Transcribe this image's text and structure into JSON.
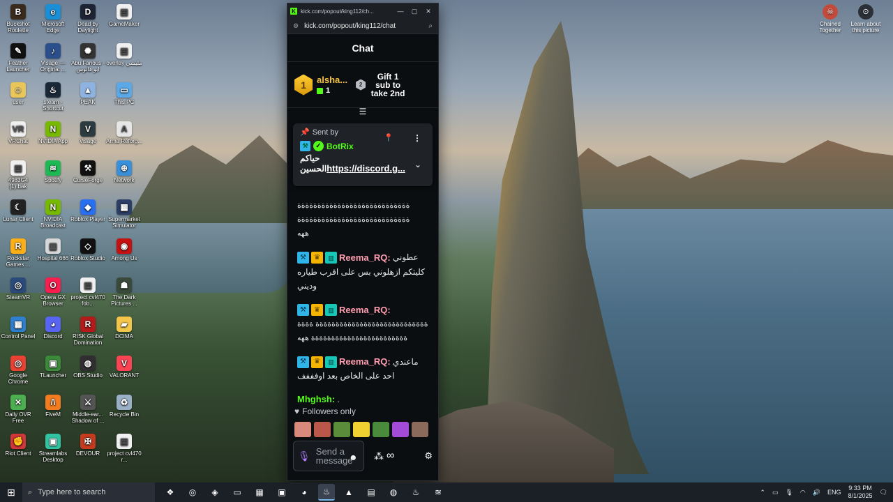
{
  "desktop_icons": [
    {
      "label": "Buckshot Roulette",
      "color": "#3a2b1c",
      "glyph": "B"
    },
    {
      "label": "Microsoft Edge",
      "color": "#1b8fd6",
      "glyph": "e"
    },
    {
      "label": "Dead by Daylight",
      "color": "#1d2433",
      "glyph": "D"
    },
    {
      "label": "GameMaker",
      "color": "#f0f0f0",
      "glyph": "▤"
    },
    {
      "label": "Feather Launcher",
      "color": "#111111",
      "glyph": "✎"
    },
    {
      "label": "Visage — Original ...",
      "color": "#2a4f8a",
      "glyph": "♪"
    },
    {
      "label": "Abu Fanous - ابو فانوس",
      "color": "#333333",
      "glyph": "✺"
    },
    {
      "label": "overlay مليشي",
      "color": "#f0f0f0",
      "glyph": "▤"
    },
    {
      "label": "user",
      "color": "#e8c65a",
      "glyph": "☺"
    },
    {
      "label": "steam - Shortcut",
      "color": "#1b2838",
      "glyph": "♨"
    },
    {
      "label": "PEAK",
      "color": "#8fb3e0",
      "glyph": "▲"
    },
    {
      "label": "This PC",
      "color": "#5aa8e6",
      "glyph": "▭"
    },
    {
      "label": "VRChat",
      "color": "#f0f0f0",
      "glyph": "VR"
    },
    {
      "label": "NVIDIA App",
      "color": "#76b900",
      "glyph": "N"
    },
    {
      "label": "Visage",
      "color": "#2b3b3f",
      "glyph": "V"
    },
    {
      "label": "Arma Reforg...",
      "color": "#e6e6e6",
      "glyph": "A"
    },
    {
      "label": "4983G4 (1).bak",
      "color": "#f0f0f0",
      "glyph": "▤"
    },
    {
      "label": "Spotify",
      "color": "#1db954",
      "glyph": "≋"
    },
    {
      "label": "CurseForge",
      "color": "#111111",
      "glyph": "⚒"
    },
    {
      "label": "Network",
      "color": "#3a8fd9",
      "glyph": "⊕"
    },
    {
      "label": "Lunar Client",
      "color": "#222222",
      "glyph": "☾"
    },
    {
      "label": "NVIDIA Broadcast",
      "color": "#76b900",
      "glyph": "N"
    },
    {
      "label": "Roblox Player",
      "color": "#2a6ff0",
      "glyph": "◆"
    },
    {
      "label": "Supermarket Simulator",
      "color": "#2c3e66",
      "glyph": "▦"
    },
    {
      "label": "Rockstar Games ...",
      "color": "#fcaf17",
      "glyph": "R"
    },
    {
      "label": "Hospital 666",
      "color": "#d8d8d8",
      "glyph": "▦"
    },
    {
      "label": "Roblox Studio",
      "color": "#111111",
      "glyph": "◇"
    },
    {
      "label": "Among Us",
      "color": "#c51111",
      "glyph": "◉"
    },
    {
      "label": "SteamVR",
      "color": "#2a4a7a",
      "glyph": "◎"
    },
    {
      "label": "Opera GX Browser",
      "color": "#fa1e4e",
      "glyph": "O"
    },
    {
      "label": "project cvl470 fob...",
      "color": "#f0f0f0",
      "glyph": "▤"
    },
    {
      "label": "The Dark Pictures ...",
      "color": "#3a4a3a",
      "glyph": "☗"
    },
    {
      "label": "Control Panel",
      "color": "#2f7fd1",
      "glyph": "▦"
    },
    {
      "label": "Discord",
      "color": "#5865f2",
      "glyph": "◕"
    },
    {
      "label": "RISK Global Domination",
      "color": "#b31b1b",
      "glyph": "R"
    },
    {
      "label": "DCIMA",
      "color": "#f3c54a",
      "glyph": "▰"
    },
    {
      "label": "Google Chrome",
      "color": "#e94235",
      "glyph": "◎"
    },
    {
      "label": "TLauncher",
      "color": "#3a8a3a",
      "glyph": "▣"
    },
    {
      "label": "OBS Studio",
      "color": "#302e31",
      "glyph": "◍"
    },
    {
      "label": "VALORANT",
      "color": "#fa4454",
      "glyph": "V"
    },
    {
      "label": "Daily OVR Free",
      "color": "#4caf50",
      "glyph": "✕"
    },
    {
      "label": "FiveM",
      "color": "#f47c20",
      "glyph": "/\\"
    },
    {
      "label": "Middle-ear... Shadow of ...",
      "color": "#555555",
      "glyph": "⚔"
    },
    {
      "label": "Recycle Bin",
      "color": "#9ab0c6",
      "glyph": "♻"
    },
    {
      "label": "Riot Client",
      "color": "#d13639",
      "glyph": "✊"
    },
    {
      "label": "Streamlabs Desktop",
      "color": "#31c3a2",
      "glyph": "▣"
    },
    {
      "label": "DEVOUR",
      "color": "#c43b1d",
      "glyph": "✠"
    },
    {
      "label": "project cvl470 r...",
      "color": "#f0f0f0",
      "glyph": "▤"
    }
  ],
  "top_right_icons": [
    {
      "label": "Chained Together",
      "color": "#c24b3b",
      "glyph": "☠"
    },
    {
      "label": "Learn about this picture",
      "color": "#2b2f36",
      "glyph": "⊙"
    }
  ],
  "browser": {
    "tab_title": "kick.com/popout/king112/ch...",
    "url": "kick.com/popout/king112/chat",
    "minimize": "—",
    "maximize": "▢",
    "close": "✕"
  },
  "chat": {
    "header": "Chat",
    "leader": {
      "rank": "1",
      "name": "alsha...",
      "count": "1"
    },
    "gift": {
      "rank": "2",
      "text": "Gift 1 sub to take 2nd"
    },
    "pinned": {
      "sent_by": "Sent by",
      "username": "BotRix",
      "line1": "حياكم",
      "line2_prefix": "الحسين",
      "line2_link": "https://discord.g..."
    },
    "scramble_top": "ةةةةةةةةةةةةةةةةةةةةةةةةةةةةةة",
    "scramble_lines": [
      "ةةةةةةةةةةةةةةةةةةةةةةةةةةةة",
      "ةةةةةةةةةةةةةةةةةةةةةةةةةةةة",
      "ههه"
    ],
    "messages": [
      {
        "user": "Reema_RQ:",
        "text": "عطوني كليتكم ازهلوني بس على اقرب طياره وديني"
      },
      {
        "user": "Reema_RQ:",
        "text": "ةةةةةةةةةةةةةةةةةةةةةةةةةةةة ةةةةةةةةةةةةةةةةةةةةةةةةةةةة ههه"
      },
      {
        "user": "Reema_RQ:",
        "text": "ماعندي احد على الخاص بعد اوفففف"
      }
    ],
    "last_message": {
      "user": "Mhghsh:",
      "text": "."
    },
    "followers_only": "Followers only",
    "emote_colors": [
      "#d98a7c",
      "#b8574a",
      "#5b8c3a",
      "#f1d032",
      "#4a8a3c",
      "#a24bd8",
      "#8a6a5a"
    ],
    "input_placeholder": "Send a message"
  },
  "taskbar": {
    "search_placeholder": "Type here to search",
    "apps": [
      "❖",
      "◎",
      "◈",
      "▭",
      "▦",
      "▣",
      "◕",
      "♨",
      "▲",
      "▤",
      "◍",
      "♨",
      "≋"
    ],
    "lang": "ENG",
    "time": "9:33 PM",
    "date": "8/1/2025",
    "notify": "3"
  }
}
